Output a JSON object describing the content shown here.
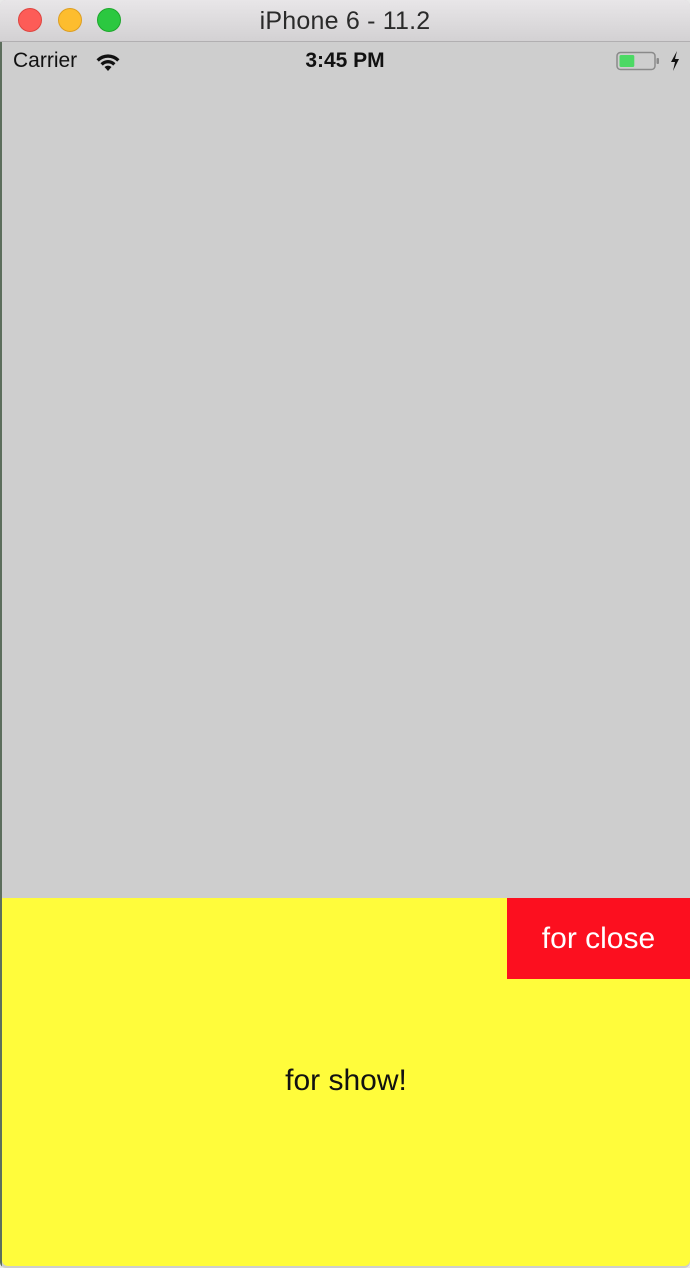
{
  "window": {
    "title": "iPhone 6 - 11.2"
  },
  "status_bar": {
    "carrier": "Carrier",
    "time": "3:45 PM",
    "battery_level": 0.45,
    "charging": true
  },
  "colors": {
    "background_gray": "#cecece",
    "sheet_yellow": "#fffc3b",
    "close_red": "#fc0f1f"
  },
  "sheet": {
    "close_label": "for close",
    "show_label": "for show!"
  }
}
